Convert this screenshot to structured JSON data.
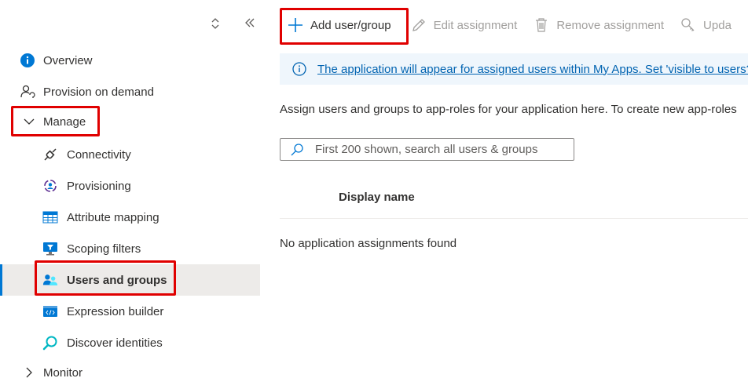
{
  "sidebar": {
    "items": [
      {
        "label": "Overview",
        "icon": "info-icon"
      },
      {
        "label": "Provision on demand",
        "icon": "user-sync-icon"
      },
      {
        "label": "Manage",
        "icon": "chevron-down-icon"
      },
      {
        "label": "Connectivity",
        "icon": "plug-icon"
      },
      {
        "label": "Provisioning",
        "icon": "provisioning-icon"
      },
      {
        "label": "Attribute mapping",
        "icon": "table-icon"
      },
      {
        "label": "Scoping filters",
        "icon": "monitor-filter-icon"
      },
      {
        "label": "Users and groups",
        "icon": "users-icon"
      },
      {
        "label": "Expression builder",
        "icon": "code-icon"
      },
      {
        "label": "Discover identities",
        "icon": "search-icon"
      },
      {
        "label": "Monitor",
        "icon": "chevron-right-icon"
      }
    ]
  },
  "toolbar": {
    "add": "Add user/group",
    "edit": "Edit assignment",
    "remove": "Remove assignment",
    "update": "Upda"
  },
  "info": {
    "text": "The application will appear for assigned users within My Apps. Set 'visible to users?'"
  },
  "description": "Assign users and groups to app-roles for your application here. To create new app-roles",
  "search": {
    "placeholder": "First 200 shown, search all users & groups"
  },
  "table": {
    "column_display_name": "Display name",
    "empty_message": "No application assignments found"
  },
  "colors": {
    "accent": "#0078d4",
    "highlight": "#e00000",
    "selected_bg": "#edebe9",
    "info_bg": "#eff6fc"
  }
}
